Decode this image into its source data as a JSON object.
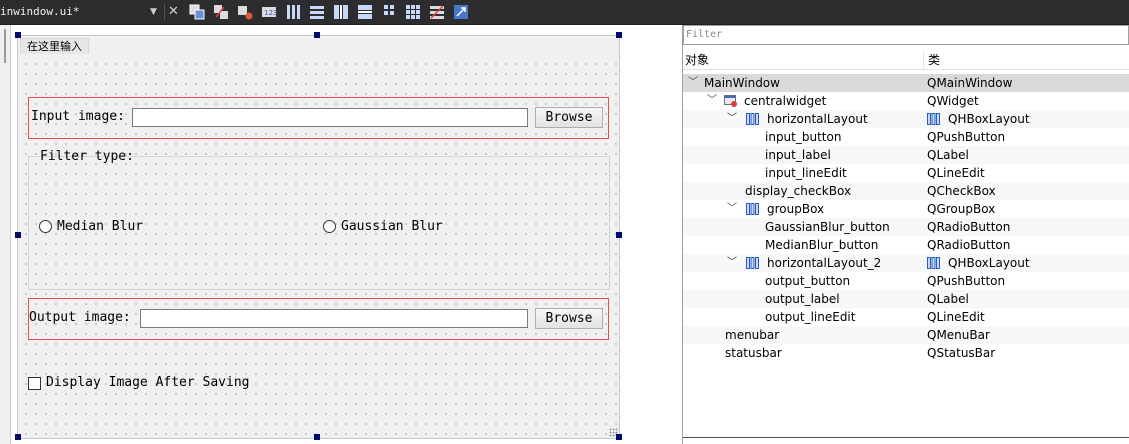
{
  "toolbar": {
    "file_tab": "inwindow.ui*",
    "dropdown_glyph": "▼",
    "close_glyph": "✕",
    "icons": [
      "edit-widgets-icon",
      "edit-signals-slots-icon",
      "edit-buddies-icon",
      "edit-tab-order-icon",
      "layout-horizontal-icon",
      "layout-vertical-icon",
      "layout-horizontal-splitter-icon",
      "layout-vertical-splitter-icon",
      "layout-form-icon",
      "layout-grid-icon",
      "break-layout-icon",
      "adjust-size-icon"
    ]
  },
  "form": {
    "menu_placeholder": "在这里输入",
    "input_label": "Input image:",
    "input_browse": "Browse",
    "filter_group_title": "Filter type:",
    "radio_median": "Median Blur",
    "radio_gaussian": "Gaussian Blur",
    "output_label": "Output image:",
    "output_browse": "Browse",
    "display_checkbox": "Display Image After Saving",
    "input_value": "",
    "output_value": ""
  },
  "inspector": {
    "filter_placeholder": "Filter",
    "col_object": "对象",
    "col_class": "类",
    "rows": [
      {
        "object": "MainWindow",
        "class": "QMainWindow"
      },
      {
        "object": "centralwidget",
        "class": "QWidget"
      },
      {
        "object": "horizontalLayout",
        "class": "QHBoxLayout"
      },
      {
        "object": "input_button",
        "class": "QPushButton"
      },
      {
        "object": "input_label",
        "class": "QLabel"
      },
      {
        "object": "input_lineEdit",
        "class": "QLineEdit"
      },
      {
        "object": "display_checkBox",
        "class": "QCheckBox"
      },
      {
        "object": "groupBox",
        "class": "QGroupBox"
      },
      {
        "object": "GaussianBlur_button",
        "class": "QRadioButton"
      },
      {
        "object": "MedianBlur_button",
        "class": "QRadioButton"
      },
      {
        "object": "horizontalLayout_2",
        "class": "QHBoxLayout"
      },
      {
        "object": "output_button",
        "class": "QPushButton"
      },
      {
        "object": "output_label",
        "class": "QLabel"
      },
      {
        "object": "output_lineEdit",
        "class": "QLineEdit"
      },
      {
        "object": "menubar",
        "class": "QMenuBar"
      },
      {
        "object": "statusbar",
        "class": "QStatusBar"
      }
    ]
  },
  "colors": {
    "selection_handle": "#000c6b",
    "layout_border": "#e05050",
    "tree_selected": "#d9d9d9",
    "layout_icon": "#2b5fbf"
  }
}
